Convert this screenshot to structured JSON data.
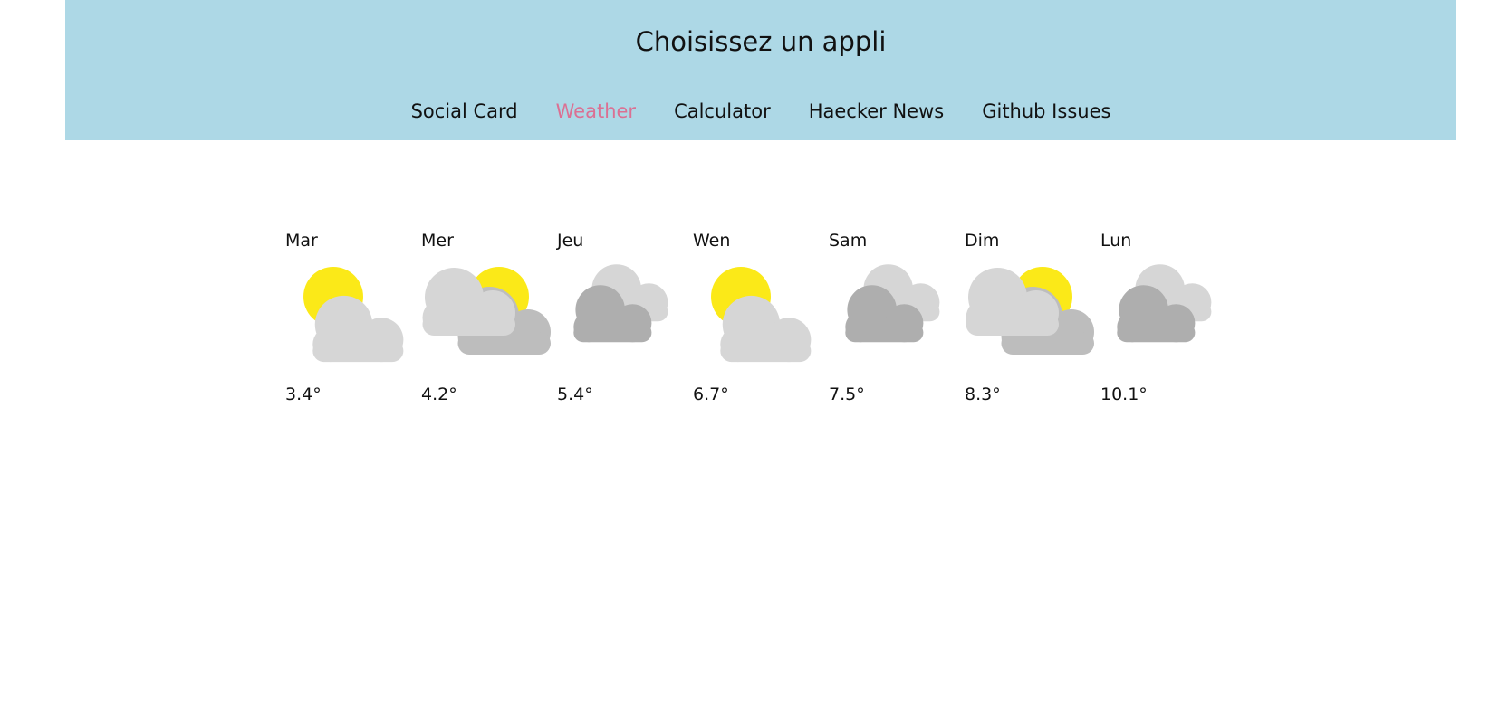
{
  "header": {
    "title": "Choisissez un appli"
  },
  "nav": {
    "items": [
      {
        "label": "Social Card",
        "active": false
      },
      {
        "label": "Weather",
        "active": true
      },
      {
        "label": "Calculator",
        "active": false
      },
      {
        "label": "Haecker News",
        "active": false
      },
      {
        "label": "Github Issues",
        "active": false
      }
    ]
  },
  "colors": {
    "header_bg": "#add8e6",
    "active_nav": "#db7093",
    "sun": "#fbe918",
    "cloud_light": "#d6d6d6",
    "cloud_mid": "#bdbdbd",
    "cloud_dark": "#aeaeae"
  },
  "forecast": [
    {
      "day": "Mar",
      "icon": "partly-sunny-icon",
      "temp": "3.4°"
    },
    {
      "day": "Mer",
      "icon": "sun-behind-clouds-icon",
      "temp": "4.2°"
    },
    {
      "day": "Jeu",
      "icon": "overcast-clouds-icon",
      "temp": "5.4°"
    },
    {
      "day": "Wen",
      "icon": "partly-sunny-icon",
      "temp": "6.7°"
    },
    {
      "day": "Sam",
      "icon": "overcast-clouds-icon",
      "temp": "7.5°"
    },
    {
      "day": "Dim",
      "icon": "sun-behind-clouds-icon",
      "temp": "8.3°"
    },
    {
      "day": "Lun",
      "icon": "overcast-clouds-icon",
      "temp": "10.1°"
    }
  ]
}
